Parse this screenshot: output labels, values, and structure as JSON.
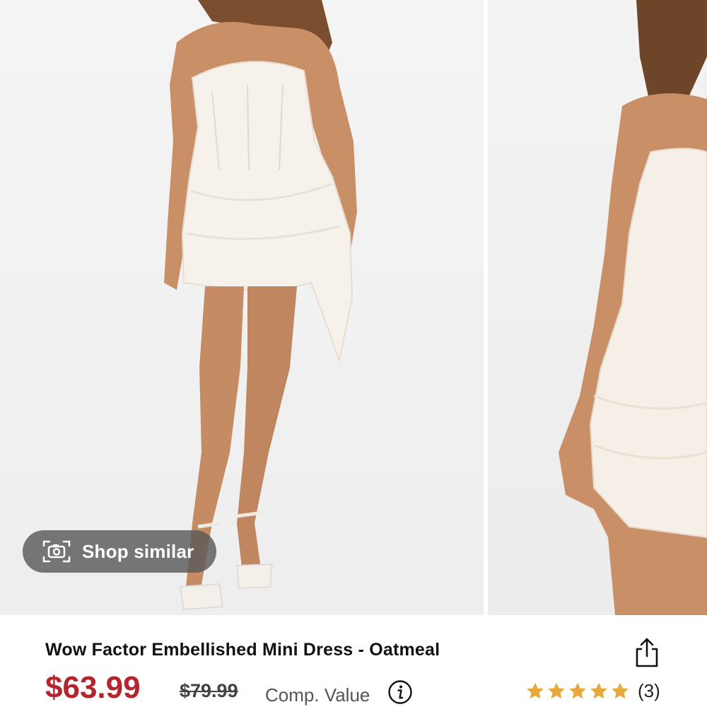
{
  "gallery": {
    "images": [
      "product photo 1 - full body",
      "product photo 2 - close up"
    ]
  },
  "shop_similar": {
    "label": "Shop similar",
    "icon": "camera-icon"
  },
  "product": {
    "title": "Wow Factor Embellished Mini Dress - Oatmeal",
    "price": "$63.99",
    "original_price": "$79.99",
    "comp_value_label": "Comp. Value",
    "rating": {
      "stars": 5,
      "count_label": "(3)",
      "star_color": "#e9a93a"
    },
    "price_color": "#b3262f"
  },
  "icons": {
    "share": "share-icon",
    "info": "info-icon"
  }
}
